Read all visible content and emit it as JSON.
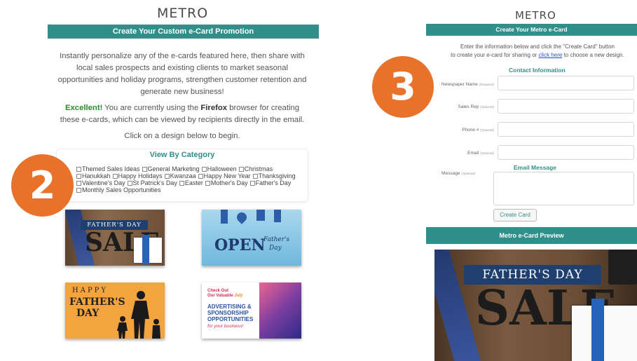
{
  "left": {
    "logo": "METRO",
    "banner": "Create Your Custom e-Card Promotion",
    "intro": "Instantly personalize any of the e-cards featured here, then share with local sales prospects and existing clients to market seasonal opportunities and holiday programs, strengthen customer retention and generate new business!",
    "browser_ok": "Excellent!",
    "browser_mid": " You are currently using the ",
    "browser_name": "Firefox",
    "browser_end": " browser for creating these e-cards, which can be viewed by recipients directly in the email.",
    "begin": "Click on a design below to begin.",
    "category_title": "View By Category",
    "categories": [
      "Themed Sales Ideas",
      "General Marketing",
      "Halloween",
      "Christmas",
      "Hanukkah",
      "Happy Holidays",
      "Kwanzaa",
      "Happy New Year",
      "Thanksgiving",
      "Valentine's Day",
      "St Patrick's Day",
      "Easter",
      "Mother's Day",
      "Father's Day",
      "Monthly Sales Opportunities"
    ],
    "thumbs": {
      "t1_top": "FATHER'S DAY",
      "t1_sale": "SALE",
      "t2_open": "OPEN",
      "t2_script1": "Father's",
      "t2_script2": "Day",
      "t3_line1": "HAPPY",
      "t3_line2": "FATHER'S",
      "t3_line3": "DAY",
      "t4_line1": "Check Out",
      "t4_line2": "Our Valuable",
      "t4_july": "July",
      "t4_line3": "ADVERTISING &",
      "t4_line4": "SPONSORSHIP",
      "t4_line5": "OPPORTUNITIES",
      "t4_line6": "for your business!"
    }
  },
  "badges": {
    "two": "2",
    "three": "3"
  },
  "right": {
    "logo": "METRO",
    "banner": "Create Your Metro e-Card",
    "instr_1": "Enter the information below and click the \"Create Card\" button",
    "instr_2a": "to create your e-card for sharing or ",
    "instr_link": "click here",
    "instr_2b": " to choose a new design.",
    "contact_head": "Contact Information",
    "fields": [
      {
        "label": "Newspaper Name",
        "note": "(Required)"
      },
      {
        "label": "Sales Rep",
        "note": "(Optional)"
      },
      {
        "label": "Phone #",
        "note": "(Optional)"
      },
      {
        "label": "Email",
        "note": "(Optional)"
      }
    ],
    "email_head": "Email Message",
    "message_label": "Message",
    "message_note": "(Optional)",
    "create_button": "Create Card",
    "preview_bar": "Metro e-Card Preview",
    "preview_top": "FATHER'S DAY",
    "preview_sale": "SALE"
  },
  "colors": {
    "teal": "#2f8f8a",
    "orange": "#e8722a",
    "navy": "#1f3f6e"
  }
}
